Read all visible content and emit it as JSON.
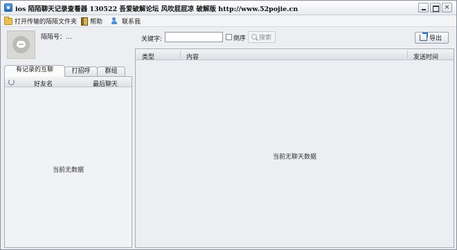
{
  "window": {
    "title": "ios 陌陌聊天记录查看器 130522 吾爱破解论坛 风吹屁屁凉 破解版 http://www.52pojie.cn"
  },
  "menu": {
    "items": [
      {
        "label": "打开传输的陌陌文件夹",
        "icon": "folder-icon"
      },
      {
        "label": "帮助",
        "icon": "help-book-icon"
      },
      {
        "label": "联系我",
        "icon": "contact-icon"
      }
    ]
  },
  "profile": {
    "momo_id_label": "陌陌号：..."
  },
  "left_tabs": [
    {
      "label": "有记录的互聊",
      "active": true
    },
    {
      "label": "打招呼",
      "active": false
    },
    {
      "label": "群组",
      "active": false
    }
  ],
  "friend_list": {
    "columns": [
      "好友名",
      "最后聊天"
    ],
    "empty_text": "当前无数据"
  },
  "search": {
    "keyword_label": "关键字:",
    "keyword_value": "",
    "reverse_label": "倒序",
    "reverse_checked": false,
    "search_button": "搜索"
  },
  "export_button": "导出",
  "chat_grid": {
    "columns": [
      "类型",
      "内容",
      "发送时间"
    ],
    "empty_text": "当前无聊天数据"
  }
}
